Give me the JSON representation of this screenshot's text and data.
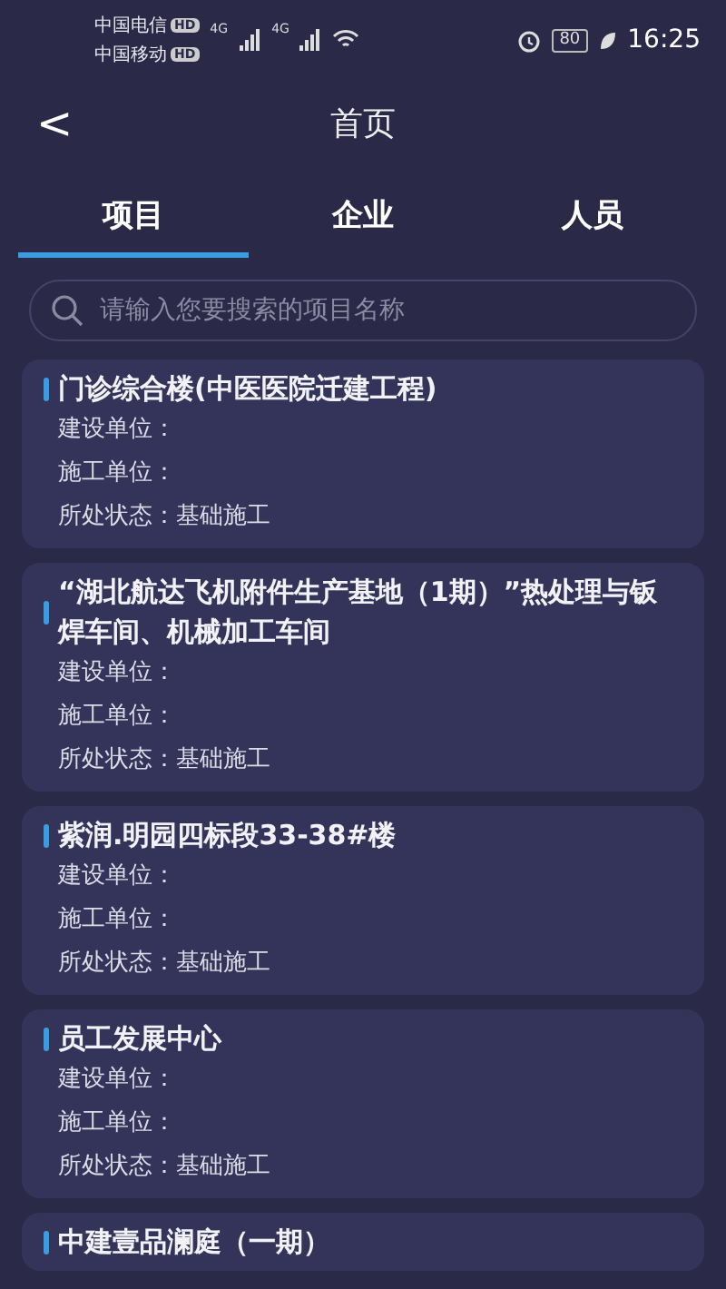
{
  "status_bar": {
    "carriers": [
      {
        "name": "中国电信",
        "badge": "HD"
      },
      {
        "name": "中国移动",
        "badge": "HD"
      }
    ],
    "network": [
      "4G",
      "4G"
    ],
    "battery": "80",
    "time": "16:25"
  },
  "header": {
    "back": "<",
    "title": "首页"
  },
  "tabs": [
    {
      "label": "项目",
      "selected": true
    },
    {
      "label": "企业",
      "selected": false
    },
    {
      "label": "人员",
      "selected": false
    }
  ],
  "search": {
    "placeholder": "请输入您要搜索的项目名称"
  },
  "projects": [
    {
      "title": "门诊综合楼(中医医院迁建工程)",
      "fields": [
        {
          "label": "建设单位："
        },
        {
          "label": "施工单位："
        },
        {
          "label": "所处状态：",
          "value": "基础施工"
        }
      ]
    },
    {
      "title": "“湖北航达飞机附件生产基地（1期）”热处理与钣焊车间、机械加工车间",
      "fields": [
        {
          "label": "建设单位："
        },
        {
          "label": "施工单位："
        },
        {
          "label": "所处状态：",
          "value": "基础施工"
        }
      ]
    },
    {
      "title": "紫润.明园四标段33-38#楼",
      "fields": [
        {
          "label": "建设单位："
        },
        {
          "label": "施工单位："
        },
        {
          "label": "所处状态：",
          "value": "基础施工"
        }
      ]
    },
    {
      "title": "员工发展中心",
      "fields": [
        {
          "label": "建设单位："
        },
        {
          "label": "施工单位："
        },
        {
          "label": "所处状态：",
          "value": "基础施工"
        }
      ]
    },
    {
      "title": "中建壹品澜庭（一期）"
    }
  ]
}
